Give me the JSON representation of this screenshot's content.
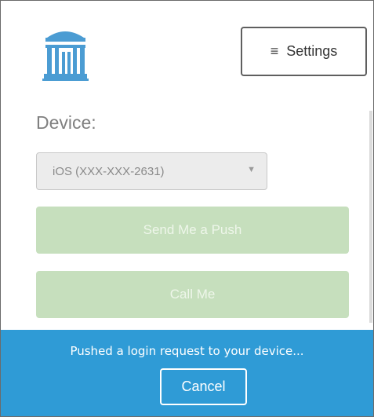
{
  "header": {
    "logo_icon": "old-well-logo-icon",
    "settings_label": "Settings",
    "settings_icon": "hamburger-menu-icon"
  },
  "device": {
    "label": "Device:",
    "selected": "iOS (XXX-XXX-2631)",
    "caret": "▼"
  },
  "actions": {
    "push_label": "Send Me a Push",
    "call_label": "Call Me",
    "disabled_color": "#c6dfbd"
  },
  "status": {
    "message": "Pushed a login request to your device...",
    "cancel_label": "Cancel",
    "banner_color": "#2f9bd6"
  }
}
